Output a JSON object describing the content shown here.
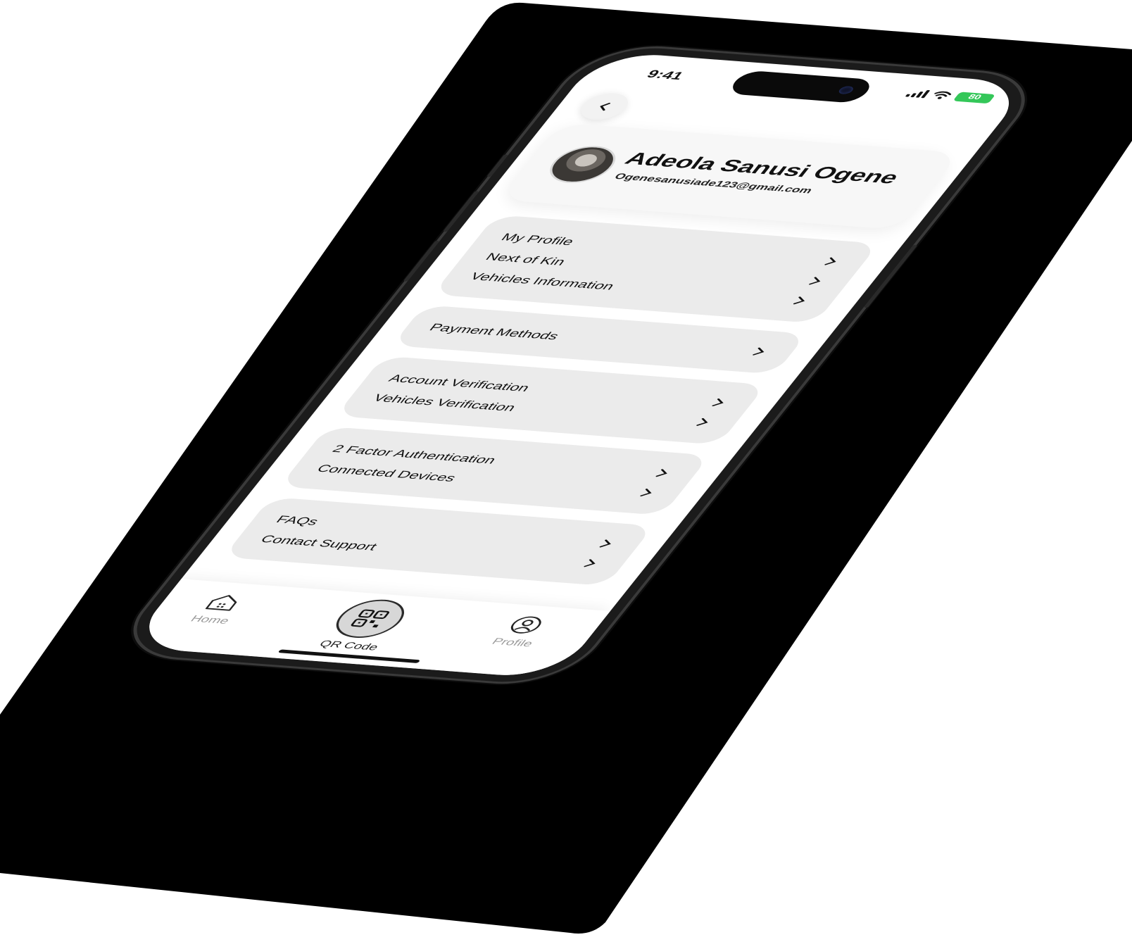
{
  "status_bar": {
    "time": "9:41",
    "battery": "80"
  },
  "profile": {
    "name": "Adeola Sanusi Ogene",
    "email": "Ogenesanusiade123@gmail.com"
  },
  "menu_groups": [
    {
      "items": [
        {
          "label": "My Profile"
        },
        {
          "label": "Next of Kin"
        },
        {
          "label": "Vehicles Information"
        }
      ]
    },
    {
      "items": [
        {
          "label": "Payment Methods"
        }
      ]
    },
    {
      "items": [
        {
          "label": "Account Verification"
        },
        {
          "label": "Vehicles Verification"
        }
      ]
    },
    {
      "items": [
        {
          "label": "2 Factor Authentication"
        },
        {
          "label": "Connected Devices"
        }
      ]
    },
    {
      "items": [
        {
          "label": "FAQs"
        },
        {
          "label": "Contact Support"
        }
      ]
    }
  ],
  "tab_bar": {
    "home_label": "Home",
    "qr_label": "QR Code",
    "profile_label": "Profile"
  },
  "icons": {
    "back": "chevron-left-icon",
    "chevron": "chevron-right-icon",
    "home": "home-icon",
    "qr": "qr-code-icon",
    "profile": "user-circle-icon"
  },
  "colors": {
    "backdrop": "#000000",
    "card": "#ebebeb",
    "battery": "#34c759",
    "tab_inactive": "#9a9a9a"
  }
}
